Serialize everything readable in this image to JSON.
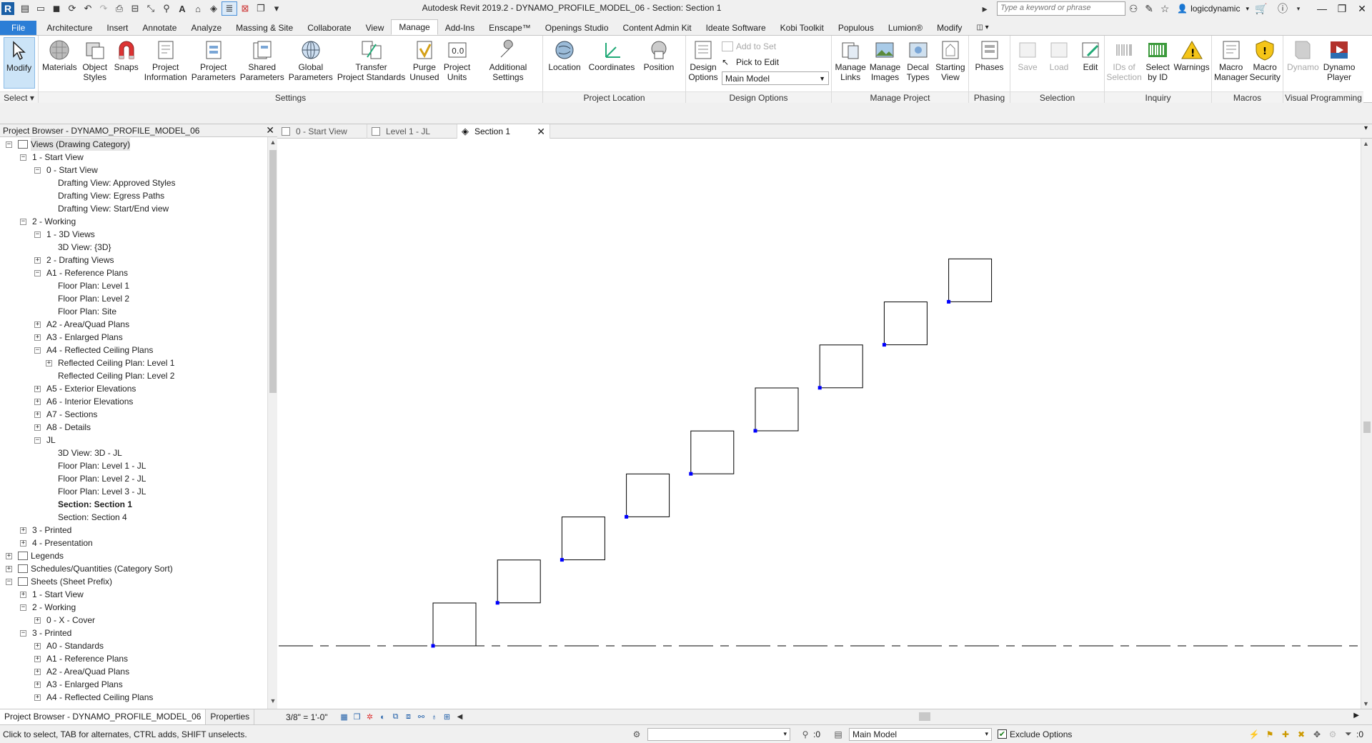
{
  "window": {
    "title": "Autodesk Revit 2019.2 - DYNAMO_PROFILE_MODEL_06 - Section: Section 1",
    "search_placeholder": "Type a keyword or phrase",
    "user": "logicdynamic"
  },
  "tabs": [
    "File",
    "Architecture",
    "Insert",
    "Annotate",
    "Analyze",
    "Massing & Site",
    "Collaborate",
    "View",
    "Manage",
    "Add-Ins",
    "Enscape™",
    "Openings Studio",
    "Content Admin Kit",
    "Ideate Software",
    "Kobi Toolkit",
    "Populous",
    "Lumion®",
    "Modify"
  ],
  "active_tab": "Manage",
  "ribbon": {
    "select": {
      "modify": "Modify",
      "label": "Select ▾"
    },
    "settings": {
      "label": "Settings",
      "buttons": [
        "Materials",
        "Object\nStyles",
        "Snaps",
        "Project\nInformation",
        "Project\nParameters",
        "Shared\nParameters",
        "Global\nParameters",
        "Transfer\nProject Standards",
        "Purge\nUnused",
        "Project\nUnits",
        "Additional\nSettings"
      ]
    },
    "project_location": {
      "label": "Project Location",
      "buttons": [
        "Location",
        "Coordinates",
        "Position"
      ]
    },
    "design_options": {
      "label": "Design Options",
      "button": "Design\nOptions",
      "add_to_set": "Add to Set",
      "pick_to_edit": "Pick to Edit",
      "main_model": "Main Model"
    },
    "manage_project": {
      "label": "Manage Project",
      "buttons": [
        "Manage\nLinks",
        "Manage\nImages",
        "Decal\nTypes",
        "Starting\nView"
      ]
    },
    "phasing": {
      "label": "Phasing",
      "button": "Phases"
    },
    "selection": {
      "label": "Selection",
      "buttons": [
        "Save",
        "Load",
        "Edit"
      ]
    },
    "inquiry": {
      "label": "Inquiry",
      "buttons": [
        "IDs of\nSelection",
        "Select\nby ID",
        "Warnings"
      ]
    },
    "macros": {
      "label": "Macros",
      "buttons": [
        "Macro\nManager",
        "Macro\nSecurity"
      ]
    },
    "visual_programming": {
      "label": "Visual Programming",
      "buttons": [
        "Dynamo",
        "Dynamo\nPlayer"
      ]
    }
  },
  "project_browser": {
    "title": "Project Browser - DYNAMO_PROFILE_MODEL_06",
    "tree": [
      {
        "l": 0,
        "t": "-",
        "icon": true,
        "text": "Views (Drawing Category)",
        "sel": true
      },
      {
        "l": 1,
        "t": "-",
        "text": "1 - Start View"
      },
      {
        "l": 2,
        "t": "-",
        "text": "0 - Start View"
      },
      {
        "l": 3,
        "t": "",
        "text": "Drafting View: Approved Styles"
      },
      {
        "l": 3,
        "t": "",
        "text": "Drafting View: Egress Paths"
      },
      {
        "l": 3,
        "t": "",
        "text": "Drafting View: Start/End view"
      },
      {
        "l": 1,
        "t": "-",
        "text": "2 - Working"
      },
      {
        "l": 2,
        "t": "-",
        "text": "1 - 3D Views"
      },
      {
        "l": 3,
        "t": "",
        "text": "3D View: {3D}"
      },
      {
        "l": 2,
        "t": "+",
        "text": "2 - Drafting Views"
      },
      {
        "l": 2,
        "t": "-",
        "text": "A1 - Reference Plans"
      },
      {
        "l": 3,
        "t": "",
        "text": "Floor Plan: Level 1"
      },
      {
        "l": 3,
        "t": "",
        "text": "Floor Plan: Level 2"
      },
      {
        "l": 3,
        "t": "",
        "text": "Floor Plan: Site"
      },
      {
        "l": 2,
        "t": "+",
        "text": "A2 - Area/Quad Plans"
      },
      {
        "l": 2,
        "t": "+",
        "text": "A3 - Enlarged Plans"
      },
      {
        "l": 2,
        "t": "-",
        "text": "A4 - Reflected Ceiling Plans"
      },
      {
        "l": 3,
        "t": "+",
        "text": "Reflected Ceiling Plan: Level 1"
      },
      {
        "l": 3,
        "t": "",
        "text": "Reflected Ceiling Plan: Level 2"
      },
      {
        "l": 2,
        "t": "+",
        "text": "A5 - Exterior Elevations"
      },
      {
        "l": 2,
        "t": "+",
        "text": "A6 - Interior Elevations"
      },
      {
        "l": 2,
        "t": "+",
        "text": "A7 - Sections"
      },
      {
        "l": 2,
        "t": "+",
        "text": "A8 - Details"
      },
      {
        "l": 2,
        "t": "-",
        "text": "JL"
      },
      {
        "l": 3,
        "t": "",
        "text": "3D View: 3D - JL"
      },
      {
        "l": 3,
        "t": "",
        "text": "Floor Plan: Level 1 - JL"
      },
      {
        "l": 3,
        "t": "",
        "text": "Floor Plan: Level 2 - JL"
      },
      {
        "l": 3,
        "t": "",
        "text": "Floor Plan: Level 3 - JL"
      },
      {
        "l": 3,
        "t": "",
        "text": "Section: Section 1",
        "bold": true
      },
      {
        "l": 3,
        "t": "",
        "text": "Section: Section 4"
      },
      {
        "l": 1,
        "t": "+",
        "text": "3 - Printed"
      },
      {
        "l": 1,
        "t": "+",
        "text": "4 - Presentation"
      },
      {
        "l": 0,
        "t": "+",
        "icon": true,
        "text": "Legends"
      },
      {
        "l": 0,
        "t": "+",
        "icon": true,
        "text": "Schedules/Quantities (Category Sort)"
      },
      {
        "l": 0,
        "t": "-",
        "icon": true,
        "text": "Sheets (Sheet Prefix)"
      },
      {
        "l": 1,
        "t": "+",
        "text": "1 - Start View"
      },
      {
        "l": 1,
        "t": "-",
        "text": "2 - Working"
      },
      {
        "l": 2,
        "t": "+",
        "text": "0 - X - Cover"
      },
      {
        "l": 1,
        "t": "-",
        "text": "3 - Printed"
      },
      {
        "l": 2,
        "t": "+",
        "text": "A0 - Standards"
      },
      {
        "l": 2,
        "t": "+",
        "text": "A1 - Reference Plans"
      },
      {
        "l": 2,
        "t": "+",
        "text": "A2 - Area/Quad Plans"
      },
      {
        "l": 2,
        "t": "+",
        "text": "A3 - Enlarged Plans"
      },
      {
        "l": 2,
        "t": "+",
        "text": "A4 - Reflected Ceiling Plans"
      }
    ],
    "footer_tabs": [
      "Project Browser - DYNAMO_PROFILE_MODEL_06",
      "Properties"
    ]
  },
  "view_tabs": [
    {
      "label": "0 - Start View",
      "active": false
    },
    {
      "label": "Level 1 - JL",
      "active": false
    },
    {
      "label": "Section 1",
      "active": true
    }
  ],
  "canvas": {
    "box_count": 9
  },
  "view_bar": {
    "scale": "3/8\" = 1'-0\""
  },
  "status": {
    "text": "Click to select, TAB for alternates, CTRL adds, SHIFT unselects.",
    "count1": ":0",
    "model": "Main Model",
    "exclude_options": "Exclude Options",
    "count2": ":0"
  },
  "colors": {
    "accent": "#2c7ed6",
    "grip": "#0000ff",
    "modify_bg": "#cce4f7"
  }
}
